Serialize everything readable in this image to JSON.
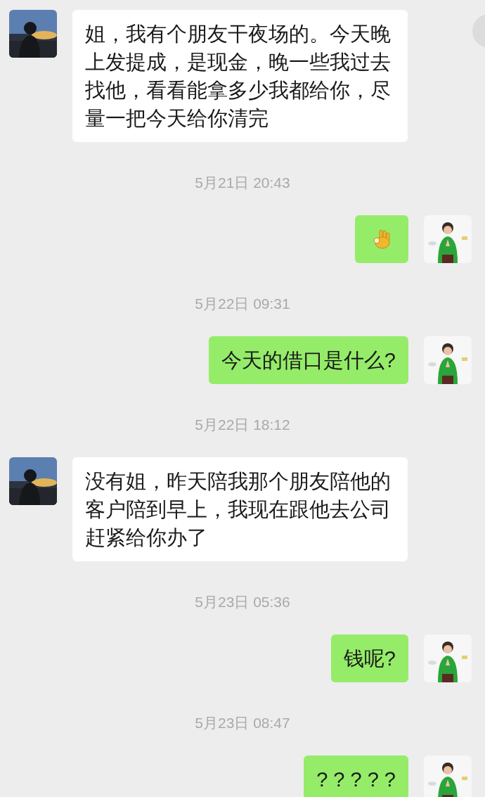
{
  "messages": [
    {
      "kind": "text",
      "outgoing": false,
      "text": "姐，我有个朋友干夜场的。今天晚上发提成，是现金，晚一些我过去找他，看看能拿多少我都给你，尽量一把今天给你清完"
    },
    {
      "kind": "time",
      "text": "5月21日 20:43"
    },
    {
      "kind": "emoji",
      "outgoing": true
    },
    {
      "kind": "time",
      "text": "5月22日 09:31"
    },
    {
      "kind": "text",
      "outgoing": true,
      "text": "今天的借口是什么?"
    },
    {
      "kind": "time",
      "text": "5月22日 18:12"
    },
    {
      "kind": "text",
      "outgoing": false,
      "text": "没有姐，昨天陪我那个朋友陪他的客户陪到早上，我现在跟他去公司赶紧给你办了"
    },
    {
      "kind": "time",
      "text": "5月23日 05:36"
    },
    {
      "kind": "text",
      "outgoing": true,
      "text": "钱呢?"
    },
    {
      "kind": "time",
      "text": "5月23日 08:47"
    },
    {
      "kind": "text",
      "outgoing": true,
      "text": "? ? ? ? ?"
    }
  ]
}
